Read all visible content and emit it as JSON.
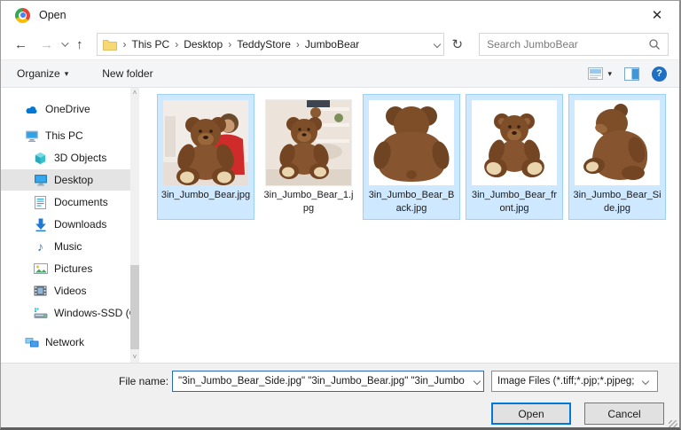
{
  "window": {
    "title": "Open"
  },
  "icons": {
    "close": "✕",
    "back": "←",
    "forward": "→",
    "up": "↑",
    "refresh": "↻",
    "breadcrumb_separator": "›",
    "dropdown_caret": "▾",
    "help": "?",
    "scroll_up": "˄",
    "scroll_down": "˅",
    "music_note": "♪"
  },
  "nav": {
    "breadcrumb": [
      "This PC",
      "Desktop",
      "TeddyStore",
      "JumboBear"
    ],
    "search_placeholder": "Search JumboBear"
  },
  "toolbar": {
    "organize_label": "Organize",
    "new_folder_label": "New folder"
  },
  "sidebar": {
    "items": [
      {
        "label": "OneDrive",
        "icon": "onedrive-cloud-icon",
        "selected": false
      },
      {
        "label": "This PC",
        "icon": "computer-icon",
        "selected": false
      },
      {
        "label": "3D Objects",
        "icon": "cube-icon",
        "selected": false
      },
      {
        "label": "Desktop",
        "icon": "desktop-icon",
        "selected": true
      },
      {
        "label": "Documents",
        "icon": "document-icon",
        "selected": false
      },
      {
        "label": "Downloads",
        "icon": "download-icon",
        "selected": false
      },
      {
        "label": "Music",
        "icon": "music-icon",
        "selected": false
      },
      {
        "label": "Pictures",
        "icon": "picture-icon",
        "selected": false
      },
      {
        "label": "Videos",
        "icon": "video-icon",
        "selected": false
      },
      {
        "label": "Windows-SSD (C",
        "icon": "drive-icon",
        "selected": false
      },
      {
        "label": "Network",
        "icon": "network-icon",
        "selected": false
      }
    ]
  },
  "files": {
    "items": [
      {
        "name": "3in_Jumbo_Bear.jpg",
        "selected": true,
        "thumbnail": "bear-with-girl"
      },
      {
        "name": "3in_Jumbo_Bear_1.jpg",
        "selected": false,
        "thumbnail": "bear-in-room"
      },
      {
        "name": "3in_Jumbo_Bear_Back.jpg",
        "selected": true,
        "thumbnail": "bear-back-view"
      },
      {
        "name": "3in_Jumbo_Bear_front.jpg",
        "selected": true,
        "thumbnail": "bear-front-view"
      },
      {
        "name": "3in_Jumbo_Bear_Side.jpg",
        "selected": true,
        "thumbnail": "bear-side-view"
      }
    ]
  },
  "footer": {
    "file_name_label": "File name:",
    "file_name_value": "\"3in_Jumbo_Bear_Side.jpg\" \"3in_Jumbo_Bear.jpg\" \"3in_Jumbo",
    "file_type_value": "Image Files (*.tiff;*.pjp;*.pjpeg;",
    "open_label": "Open",
    "cancel_label": "Cancel"
  },
  "colors": {
    "selection_fill": "#cde8ff",
    "selection_border": "#9ad1f5",
    "sidebar_selected": "#e4e4e4",
    "accent_blue": "#0078d7",
    "bear_fur": "#7d4e28",
    "bear_paw": "#e9d5ae"
  }
}
